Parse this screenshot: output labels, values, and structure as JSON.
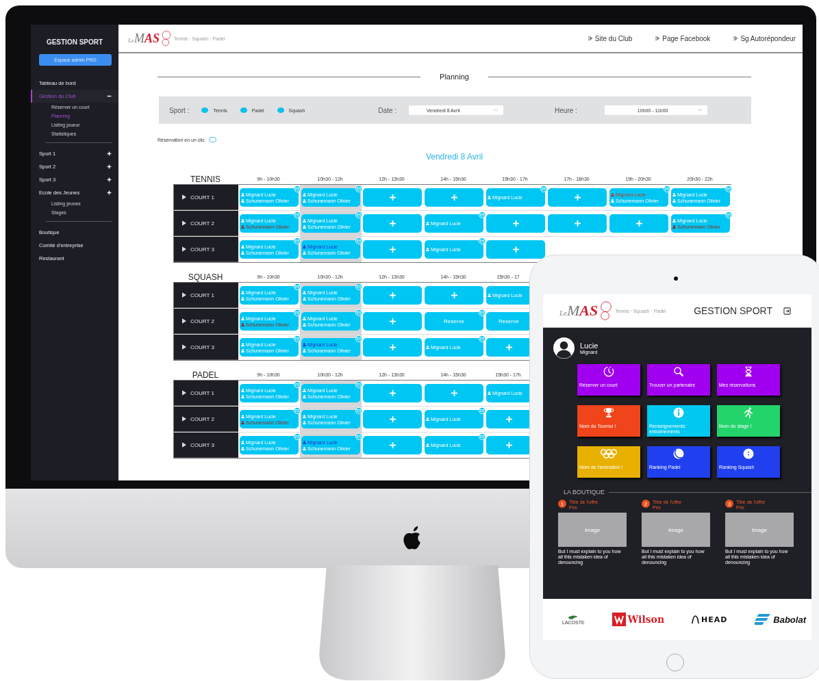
{
  "imac": {
    "sidebar": {
      "title": "GESTION SPORT",
      "admin_button": "Espace admin PRO",
      "groups": [
        [
          {
            "kind": "link",
            "label": "Tableau de bord",
            "selected": false
          },
          {
            "kind": "expandable",
            "label": "Gestion du Club",
            "selected": true,
            "expanded": true,
            "children": [
              {
                "label": "Réserver un court",
                "selected": false
              },
              {
                "label": "Planning",
                "selected": true
              },
              {
                "label": "Listing joueur",
                "selected": false
              },
              {
                "label": "Statistiques",
                "selected": false
              }
            ]
          }
        ],
        [
          {
            "kind": "expandable",
            "label": "Sport 1",
            "selected": false,
            "expanded": false
          },
          {
            "kind": "expandable",
            "label": "Sport 2",
            "selected": false,
            "expanded": false
          },
          {
            "kind": "expandable",
            "label": "Sport 3",
            "selected": false,
            "expanded": false
          },
          {
            "kind": "expandable",
            "label": "Ecole des Jeunes",
            "selected": false,
            "expanded": false,
            "children": [
              {
                "label": "Listing jeunes",
                "selected": false
              },
              {
                "label": "Stages",
                "selected": false
              }
            ]
          }
        ],
        [
          {
            "kind": "link",
            "label": "Boutique",
            "selected": false
          },
          {
            "kind": "link",
            "label": "Comité d'entreprise",
            "selected": false
          },
          {
            "kind": "link",
            "label": "Restaurant",
            "selected": false
          }
        ]
      ]
    },
    "topbar": {
      "logo": {
        "prefix": "Le",
        "name_a": "M",
        "name_b": "AS",
        "tagline": "Tennis · Squash · Padel"
      },
      "links": [
        "Site du Club",
        "Page Facebook",
        "Sg Autorépondeur"
      ]
    },
    "planning": {
      "title": "Planning",
      "filters": {
        "sport_label": "Sport :",
        "sports": [
          {
            "label": "Tennis",
            "checked": true
          },
          {
            "label": "Padel",
            "checked": true
          },
          {
            "label": "Squash",
            "checked": true
          }
        ],
        "date_label": "Date :",
        "date_value": "Vendredi 8 Avril",
        "time_label": "Heure :",
        "time_value": "10h00 - 11h00"
      },
      "one_click": {
        "label": "Réservation en un clic",
        "on": false
      },
      "date_title": "Vendredi 8 Avril",
      "sections": [
        {
          "sport": "TENNIS",
          "columns": [
            {
              "label": "9h - 10h30",
              "selected": false
            },
            {
              "label": "10h30 - 12h",
              "selected": true
            },
            {
              "label": "12h - 13h30",
              "selected": false
            },
            {
              "label": "14h - 15h30",
              "selected": false
            },
            {
              "label": "15h30 - 17h",
              "selected": false
            },
            {
              "label": "17h - 18h30",
              "selected": false
            },
            {
              "label": "19h - 20h30",
              "selected": false
            },
            {
              "label": "20h30 - 22h",
              "selected": false
            }
          ],
          "courts": [
            {
              "name": "COURT 1",
              "cells": [
                {
                  "kind": "booking",
                  "mail": true,
                  "players": [
                    {
                      "name": "Mignard Lucie",
                      "color": "#ffffff"
                    },
                    {
                      "name": "Schunemann Olivier",
                      "color": "#ffffff"
                    }
                  ]
                },
                {
                  "kind": "booking",
                  "mail": true,
                  "players": [
                    {
                      "name": "Mignard Lucie",
                      "color": "#ffffff"
                    },
                    {
                      "name": "Schunemann Olivier",
                      "color": "#ffffff"
                    }
                  ]
                },
                {
                  "kind": "add",
                  "mail": false
                },
                {
                  "kind": "add",
                  "mail": false
                },
                {
                  "kind": "booking",
                  "mail": true,
                  "players": [
                    {
                      "name": "Mignard Lucie",
                      "color": "#ffffff"
                    }
                  ]
                },
                {
                  "kind": "add",
                  "mail": false
                },
                {
                  "kind": "booking",
                  "mail": true,
                  "players": [
                    {
                      "name": "Mignard Lucie",
                      "color": "#c0392b"
                    },
                    {
                      "name": "Schunemann Olivier",
                      "color": "#ffffff"
                    }
                  ]
                },
                {
                  "kind": "booking",
                  "mail": true,
                  "players": [
                    {
                      "name": "Mignard Lucie",
                      "color": "#ffffff"
                    },
                    {
                      "name": "Schunemann Olivier",
                      "color": "#ffffff"
                    }
                  ]
                }
              ]
            },
            {
              "name": "COURT 2",
              "cells": [
                {
                  "kind": "booking",
                  "mail": true,
                  "players": [
                    {
                      "name": "Mignard Lucie",
                      "color": "#ffffff"
                    },
                    {
                      "name": "Schunemann Olivier",
                      "color": "#8b2e22"
                    }
                  ]
                },
                {
                  "kind": "booking",
                  "mail": true,
                  "players": [
                    {
                      "name": "Mignard Lucie",
                      "color": "#ffffff"
                    },
                    {
                      "name": "Schunemann Olivier",
                      "color": "#ffffff"
                    }
                  ]
                },
                {
                  "kind": "add",
                  "mail": false
                },
                {
                  "kind": "booking",
                  "mail": true,
                  "players": [
                    {
                      "name": "Mignard Lucie",
                      "color": "#ffffff"
                    }
                  ]
                },
                {
                  "kind": "add",
                  "mail": false
                },
                {
                  "kind": "add",
                  "mail": false
                },
                {
                  "kind": "add",
                  "mail": false
                },
                {
                  "kind": "booking",
                  "mail": true,
                  "players": [
                    {
                      "name": "Mignard Lucie",
                      "color": "#ffffff"
                    },
                    {
                      "name": "Schunemann Olivier",
                      "color": "#8b2e22"
                    }
                  ]
                }
              ]
            },
            {
              "name": "COURT 3",
              "cells": [
                {
                  "kind": "booking",
                  "mail": true,
                  "players": [
                    {
                      "name": "Mignard Lucie",
                      "color": "#ffffff"
                    },
                    {
                      "name": "Schunemann Olivier",
                      "color": "#ffffff"
                    }
                  ]
                },
                {
                  "kind": "booking",
                  "mail": true,
                  "players": [
                    {
                      "name": "Mignard Lucie",
                      "color": "#2536c9"
                    },
                    {
                      "name": "Schunemann Olivier",
                      "color": "#ffffff"
                    }
                  ]
                },
                {
                  "kind": "add",
                  "mail": false
                },
                {
                  "kind": "booking",
                  "mail": true,
                  "players": [
                    {
                      "name": "Mignard Lucie",
                      "color": "#ffffff"
                    }
                  ]
                },
                {
                  "kind": "add",
                  "mail": false
                }
              ]
            }
          ]
        },
        {
          "sport": "SQUASH",
          "columns": [
            {
              "label": "9h - 10h30",
              "selected": false
            },
            {
              "label": "10h30 - 12h",
              "selected": true
            },
            {
              "label": "12h - 13h30",
              "selected": false
            },
            {
              "label": "14h - 15h30",
              "selected": false
            },
            {
              "label": "15h30 - 17",
              "selected": false
            }
          ],
          "courts": [
            {
              "name": "COURT 1",
              "cells": [
                {
                  "kind": "booking",
                  "mail": true,
                  "players": [
                    {
                      "name": "Mignard Lucie",
                      "color": "#ffffff"
                    },
                    {
                      "name": "Schunemann Olivier",
                      "color": "#ffffff"
                    }
                  ]
                },
                {
                  "kind": "booking",
                  "mail": true,
                  "players": [
                    {
                      "name": "Mignard Lucie",
                      "color": "#ffffff"
                    },
                    {
                      "name": "Schunemann Olivier",
                      "color": "#ffffff"
                    }
                  ]
                },
                {
                  "kind": "add",
                  "mail": false
                },
                {
                  "kind": "add",
                  "mail": false
                },
                {
                  "kind": "booking",
                  "mail": false,
                  "players": [
                    {
                      "name": "Mignard Lucie",
                      "color": "#ffffff"
                    }
                  ]
                }
              ]
            },
            {
              "name": "COURT 2",
              "cells": [
                {
                  "kind": "booking",
                  "mail": true,
                  "players": [
                    {
                      "name": "Mignard Lucie",
                      "color": "#ffffff"
                    },
                    {
                      "name": "Schunemann Olivier",
                      "color": "#8b2e22"
                    }
                  ]
                },
                {
                  "kind": "booking",
                  "mail": true,
                  "players": [
                    {
                      "name": "Mignard Lucie",
                      "color": "#ffffff"
                    },
                    {
                      "name": "Schunemann Olivier",
                      "color": "#ffffff"
                    }
                  ]
                },
                {
                  "kind": "add",
                  "mail": false
                },
                {
                  "kind": "reserve",
                  "mail": true,
                  "label": "Reserve"
                },
                {
                  "kind": "reserve",
                  "mail": false,
                  "label": "Reserve"
                }
              ]
            },
            {
              "name": "COURT 3",
              "cells": [
                {
                  "kind": "booking",
                  "mail": true,
                  "players": [
                    {
                      "name": "Mignard Lucie",
                      "color": "#ffffff"
                    },
                    {
                      "name": "Schunemann Olivier",
                      "color": "#ffffff"
                    }
                  ]
                },
                {
                  "kind": "booking",
                  "mail": true,
                  "players": [
                    {
                      "name": "Mignard Lucie",
                      "color": "#2536c9"
                    },
                    {
                      "name": "Schunemann Olivier",
                      "color": "#ffffff"
                    }
                  ]
                },
                {
                  "kind": "add",
                  "mail": false
                },
                {
                  "kind": "booking",
                  "mail": true,
                  "players": [
                    {
                      "name": "Mignard Lucie",
                      "color": "#ffffff"
                    }
                  ]
                },
                {
                  "kind": "add",
                  "mail": false
                }
              ]
            }
          ]
        },
        {
          "sport": "PADEL",
          "columns": [
            {
              "label": "9h - 10h30",
              "selected": false
            },
            {
              "label": "10h30 - 12h",
              "selected": true
            },
            {
              "label": "12h - 13h30",
              "selected": false
            },
            {
              "label": "14h - 15h30",
              "selected": false
            },
            {
              "label": "15h30 - 17h",
              "selected": false
            }
          ],
          "courts": [
            {
              "name": "COURT 1",
              "cells": [
                {
                  "kind": "booking",
                  "mail": true,
                  "players": [
                    {
                      "name": "Mignard Lucie",
                      "color": "#ffffff"
                    },
                    {
                      "name": "Schunemann Olivier",
                      "color": "#ffffff"
                    }
                  ]
                },
                {
                  "kind": "booking",
                  "mail": true,
                  "players": [
                    {
                      "name": "Mignard Lucie",
                      "color": "#ffffff"
                    },
                    {
                      "name": "Schunemann Olivier",
                      "color": "#ffffff"
                    }
                  ]
                },
                {
                  "kind": "add",
                  "mail": false
                },
                {
                  "kind": "add",
                  "mail": false
                },
                {
                  "kind": "booking",
                  "mail": false,
                  "players": [
                    {
                      "name": "Mignard Lucie",
                      "color": "#ffffff"
                    }
                  ]
                }
              ]
            },
            {
              "name": "COURT 2",
              "cells": [
                {
                  "kind": "booking",
                  "mail": true,
                  "players": [
                    {
                      "name": "Mignard Lucie",
                      "color": "#ffffff"
                    },
                    {
                      "name": "Schunemann Olivier",
                      "color": "#8b2e22"
                    }
                  ]
                },
                {
                  "kind": "booking",
                  "mail": true,
                  "players": [
                    {
                      "name": "Mignard Lucie",
                      "color": "#ffffff"
                    },
                    {
                      "name": "Schunemann Olivier",
                      "color": "#ffffff"
                    }
                  ]
                },
                {
                  "kind": "add",
                  "mail": false
                },
                {
                  "kind": "booking",
                  "mail": true,
                  "players": [
                    {
                      "name": "Mignard Lucie",
                      "color": "#ffffff"
                    }
                  ]
                },
                {
                  "kind": "add",
                  "mail": false
                }
              ]
            },
            {
              "name": "COURT 3",
              "cells": [
                {
                  "kind": "booking",
                  "mail": true,
                  "players": [
                    {
                      "name": "Mignard Lucie",
                      "color": "#ffffff"
                    },
                    {
                      "name": "Schunemann Olivier",
                      "color": "#ffffff"
                    }
                  ]
                },
                {
                  "kind": "booking",
                  "mail": true,
                  "players": [
                    {
                      "name": "Mignard Lucie",
                      "color": "#2536c9"
                    },
                    {
                      "name": "Schunemann Olivier",
                      "color": "#ffffff"
                    }
                  ]
                },
                {
                  "kind": "add",
                  "mail": false
                },
                {
                  "kind": "booking",
                  "mail": true,
                  "players": [
                    {
                      "name": "Mignard Lucie",
                      "color": "#ffffff"
                    }
                  ]
                },
                {
                  "kind": "add",
                  "mail": false
                }
              ]
            }
          ]
        }
      ]
    }
  },
  "ipad": {
    "header": {
      "logo": {
        "prefix": "Le",
        "name_a": "M",
        "name_b": "AS",
        "tagline": "Tennis · Squash · Padel"
      },
      "title": "GESTION SPORT"
    },
    "user": {
      "first_name": "Lucie",
      "last_name": "Mignard"
    },
    "tiles": [
      {
        "label": "Réserver un court",
        "color": "#a100f0",
        "kind": "clock"
      },
      {
        "label": "Trouver un partenaire",
        "color": "#a100f0",
        "kind": "search"
      },
      {
        "label": "Mes réservations",
        "color": "#a100f0",
        "kind": "hourglass"
      },
      {
        "label": "Nom du Tournoi !",
        "color": "#f0441a",
        "kind": "trophy"
      },
      {
        "label": "Renseignements entraînements",
        "color": "#00c8f0",
        "kind": "info"
      },
      {
        "label": "Nom du stage !",
        "color": "#22d46a",
        "kind": "runner"
      },
      {
        "label": "Nom de l'animation !",
        "color": "#e8b000",
        "kind": "rings"
      },
      {
        "label": "Ranking Padel",
        "color": "#2040f0",
        "kind": "ball"
      },
      {
        "label": "Ranking Squash",
        "color": "#2040f0",
        "kind": "dot-ball"
      }
    ],
    "shop": {
      "title": "LA BOUTIQUE",
      "offers": [
        {
          "number": "1",
          "title": "Titre de l'offre",
          "price": "Prix",
          "image_label": "Image",
          "description": "But I must explain to you how all this mistaken idea of denouncing"
        },
        {
          "number": "2",
          "title": "Titre de l'offre",
          "price": "Prix",
          "image_label": "Image",
          "description": "But I must explain to you how all this mistaken idea of denouncing"
        },
        {
          "number": "3",
          "title": "Titre de l'offre",
          "price": "Prix",
          "image_label": "Image",
          "description": "But I must explain to you how all this mistaken idea of denouncing"
        }
      ]
    },
    "brands": [
      {
        "kind": "lacoste",
        "label": "LACOSTE"
      },
      {
        "kind": "wilson",
        "label": "Wilson"
      },
      {
        "kind": "head",
        "label": "HEAD"
      },
      {
        "kind": "babolat",
        "label": "Babolat"
      }
    ]
  }
}
